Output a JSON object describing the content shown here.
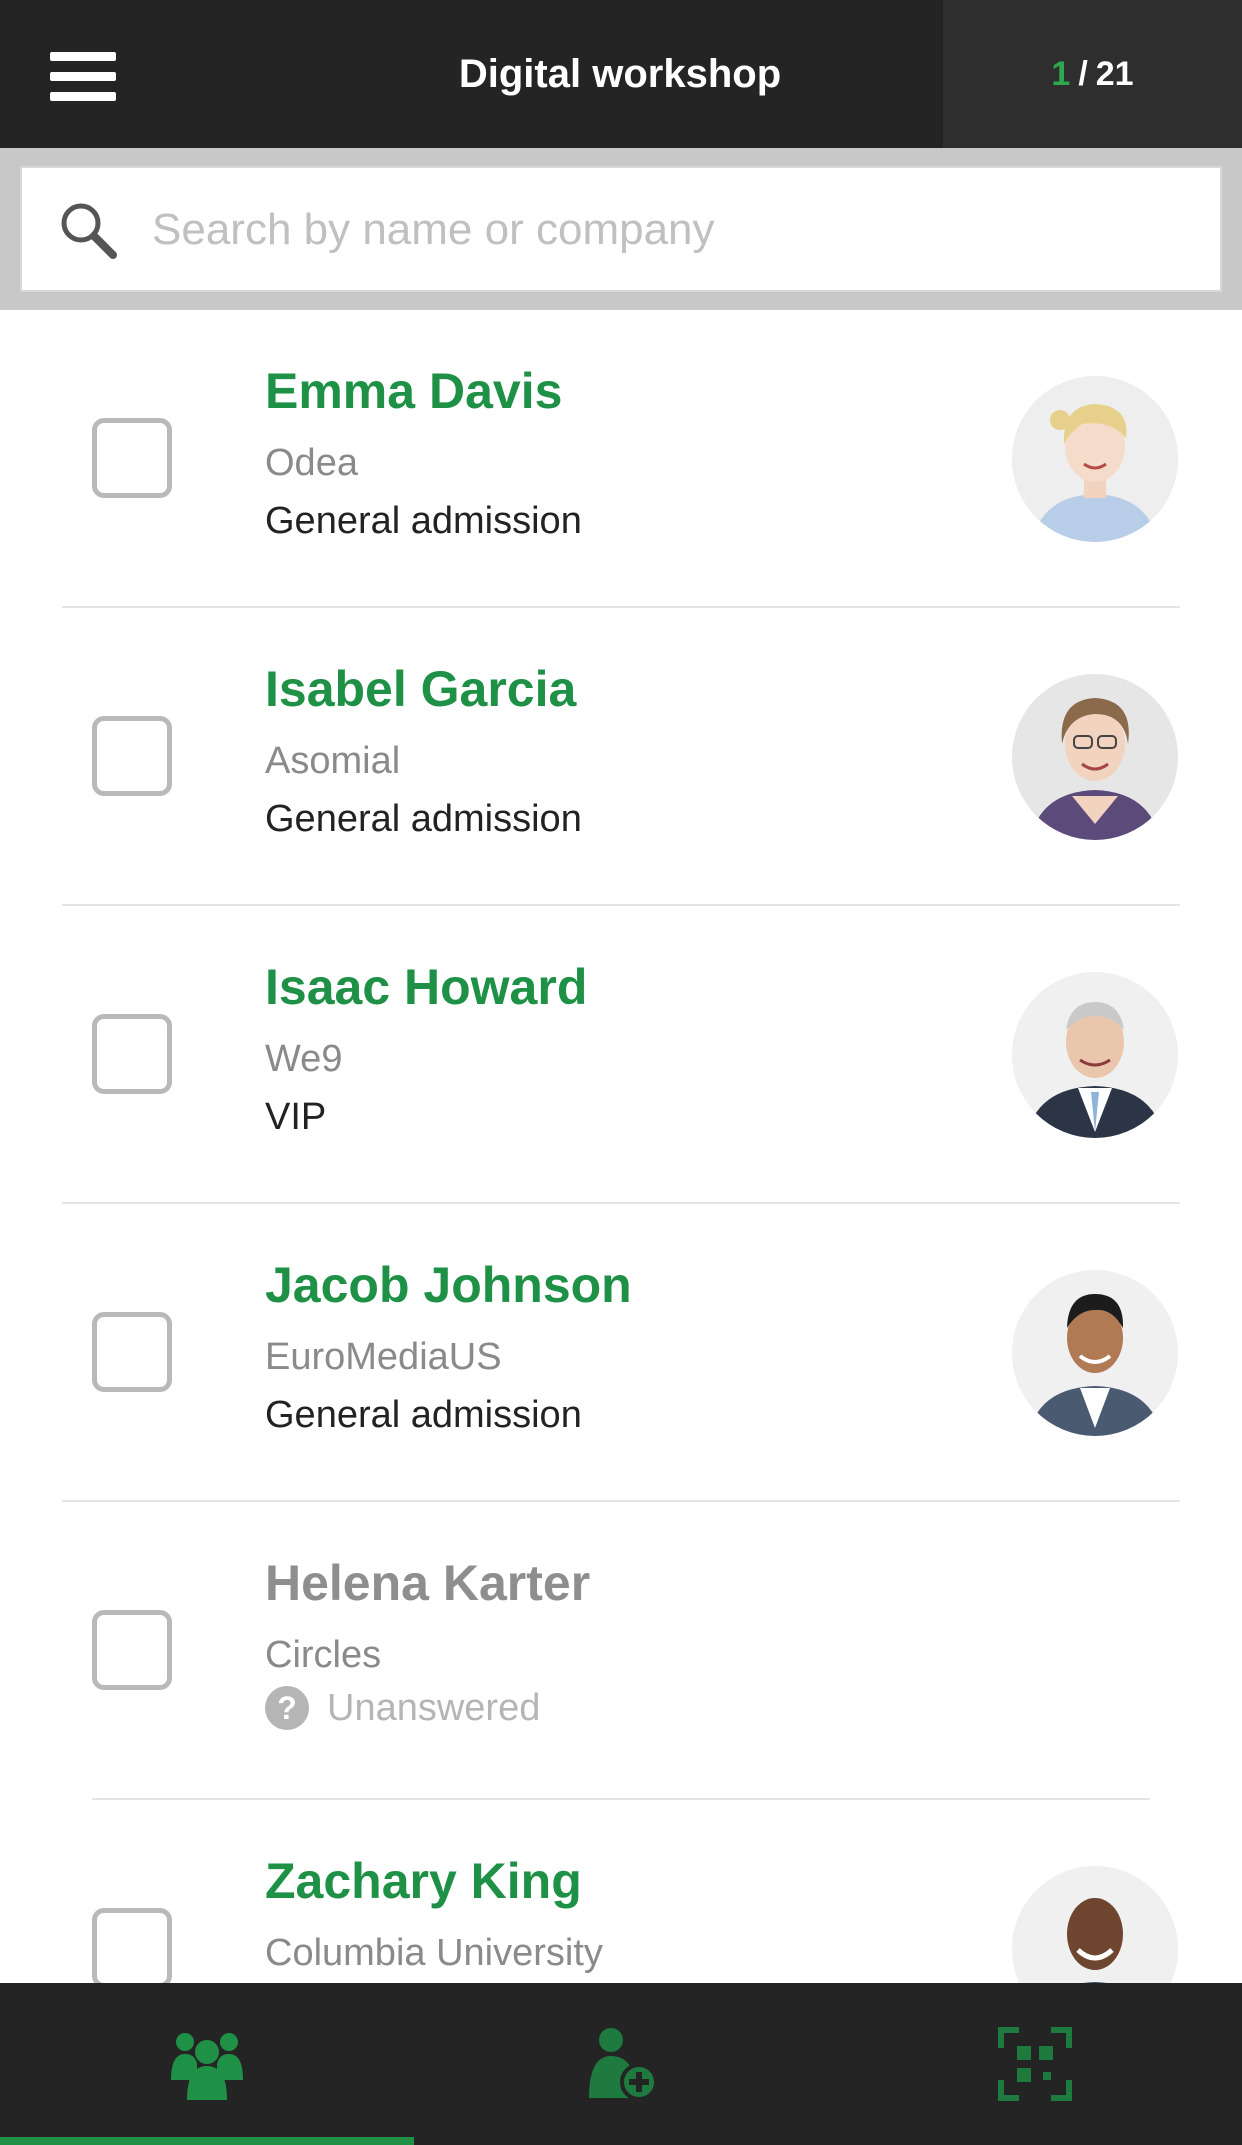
{
  "header": {
    "title": "Digital workshop",
    "counter_current": "1",
    "counter_separator": "/",
    "counter_total": "21"
  },
  "search": {
    "placeholder": "Search by name or company",
    "value": ""
  },
  "attendees": [
    {
      "name": "Emma Davis",
      "company": "Odea",
      "ticket": "General admission",
      "checked": false,
      "avatar": "woman-blonde-avatar"
    },
    {
      "name": "Isabel Garcia",
      "company": "Asomial",
      "ticket": "General admission",
      "checked": false,
      "avatar": "woman-glasses-avatar"
    },
    {
      "name": "Isaac Howard",
      "company": "We9",
      "ticket": "VIP",
      "checked": false,
      "avatar": "man-gray-suit-avatar"
    },
    {
      "name": "Jacob Johnson",
      "company": "EuroMediaUS",
      "ticket": "General admission",
      "checked": false,
      "avatar": "man-dark-suit-avatar"
    },
    {
      "name": "Helena Karter",
      "company": "Circles",
      "ticket": "Unanswered",
      "checked": false,
      "avatar": ""
    },
    {
      "name": "Zachary King",
      "company": "Columbia University",
      "ticket": "",
      "checked": false,
      "avatar": "man-smiling-avatar"
    }
  ],
  "colors": {
    "accent": "#1e9147",
    "header_bg": "#242424",
    "muted": "#8e8e8e"
  },
  "bottom_nav": {
    "items": [
      "attendees-icon",
      "add-person-icon",
      "qr-scan-icon"
    ],
    "active": "attendees-icon"
  }
}
